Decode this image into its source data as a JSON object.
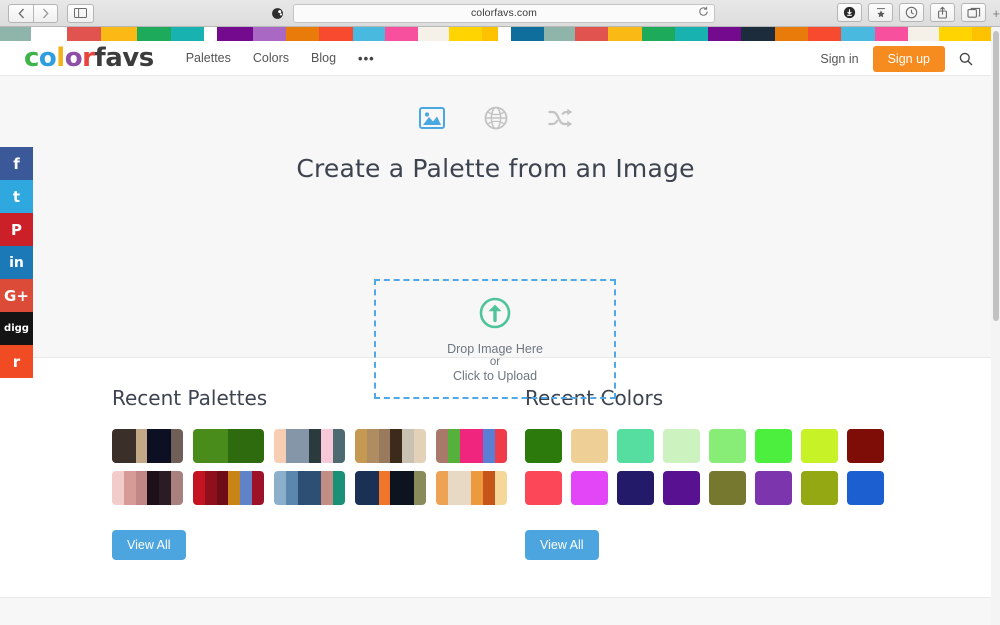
{
  "browser": {
    "back_label": "‹",
    "forward_label": "›",
    "sidebar_icon": "sidebar-icon",
    "url": "colorfavs.com",
    "reload_icon": "reload-icon",
    "favicon": "site-favicon",
    "tools": [
      "download-icon",
      "bookmarks-icon",
      "history-icon",
      "share-icon",
      "tabs-icon"
    ],
    "new_tab_label": "+"
  },
  "color_stripe": [
    "#8fb5ab",
    "#ffffff",
    "#e0534f",
    "#fbb916",
    "#1dab5b",
    "#18b2b0",
    "#ffffff",
    "#740b8e",
    "#a968c4",
    "#e87b09",
    "#f74a2f",
    "#4ab9df",
    "#f7509e",
    "#f5f1e8",
    "#ffd400",
    "#fcc200",
    "#ffffff",
    "#0f6e9c",
    "#8fb5ab",
    "#e0534f",
    "#fbb916",
    "#1dab5b",
    "#18b2b0",
    "#740b8e",
    "#1c2c3c",
    "#e87b09",
    "#f74a2f",
    "#4ab9df",
    "#f7509e",
    "#f5f1e8",
    "#ffd400",
    "#fcc200"
  ],
  "header": {
    "logo_color_text": "color",
    "logo_favs_text": "favs",
    "logo_letters": [
      {
        "ch": "c",
        "color": "#3fb24a"
      },
      {
        "ch": "o",
        "color": "#2f9de0"
      },
      {
        "ch": "l",
        "color": "#f6b21b"
      },
      {
        "ch": "o",
        "color": "#8e4fa8"
      },
      {
        "ch": "r",
        "color": "#e8443c"
      }
    ],
    "nav": [
      {
        "label": "Palettes",
        "name": "nav-palettes"
      },
      {
        "label": "Colors",
        "name": "nav-colors"
      },
      {
        "label": "Blog",
        "name": "nav-blog"
      }
    ],
    "more_label": "•••",
    "sign_in_label": "Sign in",
    "sign_up_label": "Sign up",
    "search_icon": "search-icon",
    "accent_orange": "#f68b1f"
  },
  "hero": {
    "tabs": [
      {
        "icon": "image-icon",
        "name": "tab-from-image",
        "active": true
      },
      {
        "icon": "globe-icon",
        "name": "tab-from-url",
        "active": false
      },
      {
        "icon": "shuffle-icon",
        "name": "tab-random",
        "active": false
      }
    ],
    "title": "Create a Palette from an Image",
    "dropzone": {
      "icon": "upload-arrow-icon",
      "line1": "Drop Image Here",
      "line2": "or",
      "line3": "Click to Upload",
      "border_color": "#4fa8e8",
      "icon_color": "#4ec49a"
    }
  },
  "social": [
    {
      "name": "facebook",
      "label": "f",
      "color": "#3b5998"
    },
    {
      "name": "twitter",
      "label": "t",
      "color": "#2fa8e0"
    },
    {
      "name": "pinterest",
      "label": "P",
      "color": "#cb2027"
    },
    {
      "name": "linkedin",
      "label": "in",
      "color": "#1c79b8"
    },
    {
      "name": "googleplus",
      "label": "G+",
      "color": "#dc4a38"
    },
    {
      "name": "digg",
      "label": "digg",
      "color": "#141414"
    },
    {
      "name": "reddit",
      "label": "r",
      "color": "#f04b23"
    }
  ],
  "palettes_section": {
    "title": "Recent Palettes",
    "view_all_label": "View All",
    "rows": [
      [
        {
          "name": "palette-1",
          "colors": [
            "#3b2f2a",
            "#3b2f2a",
            "#c2a886",
            "#0d0f22",
            "#0d0f22",
            "#6f5f57"
          ]
        },
        {
          "name": "palette-2",
          "colors": [
            "#4a8c1c",
            "#4a8c1c",
            "#4a8c1c",
            "#2e6b0e",
            "#2e6b0e",
            "#2e6b0e"
          ]
        },
        {
          "name": "palette-3",
          "colors": [
            "#f7cdb4",
            "#8496a8",
            "#8496a8",
            "#2b3a3c",
            "#f7c9d8",
            "#4d6a70"
          ]
        },
        {
          "name": "palette-4",
          "colors": [
            "#c49a52",
            "#b08c63",
            "#9a7a5c",
            "#3c2a1a",
            "#c9c2b3",
            "#e3d2b8"
          ]
        },
        {
          "name": "palette-5",
          "colors": [
            "#a8796a",
            "#56b03c",
            "#f0257e",
            "#f0257e",
            "#5b7fd4",
            "#ee3c4a"
          ]
        }
      ],
      [
        {
          "name": "palette-6",
          "colors": [
            "#f2ccc9",
            "#d79b97",
            "#c08784",
            "#1e1018",
            "#2b1b24",
            "#a8807e"
          ]
        },
        {
          "name": "palette-7",
          "colors": [
            "#c41421",
            "#8f0f1c",
            "#6e0d17",
            "#c98418",
            "#5f83c6",
            "#9e1227"
          ]
        },
        {
          "name": "palette-8",
          "colors": [
            "#8cb0cc",
            "#5a87ad",
            "#2e4f74",
            "#2e4f74",
            "#c28d84",
            "#1a9177"
          ]
        },
        {
          "name": "palette-9",
          "colors": [
            "#1a3054",
            "#1a3054",
            "#f0762b",
            "#0d1420",
            "#0d1420",
            "#8a8b5a"
          ]
        },
        {
          "name": "palette-10",
          "colors": [
            "#eda254",
            "#e8d9c4",
            "#e8d9c4",
            "#ec9a3e",
            "#c6551a",
            "#f5d79a"
          ]
        }
      ]
    ]
  },
  "colors_section": {
    "title": "Recent Colors",
    "view_all_label": "View All",
    "rows": [
      [
        {
          "name": "color-swatch-1",
          "hex": "#2b7a0b"
        },
        {
          "name": "color-swatch-2",
          "hex": "#eecf95"
        },
        {
          "name": "color-swatch-3",
          "hex": "#56deA0"
        },
        {
          "name": "color-swatch-4",
          "hex": "#ccf2c0"
        },
        {
          "name": "color-swatch-5",
          "hex": "#88ed77"
        },
        {
          "name": "color-swatch-6",
          "hex": "#4cef3e"
        },
        {
          "name": "color-swatch-7",
          "hex": "#c6f227"
        },
        {
          "name": "color-swatch-8",
          "hex": "#7e0d07"
        }
      ],
      [
        {
          "name": "color-swatch-9",
          "hex": "#fc4759"
        },
        {
          "name": "color-swatch-10",
          "hex": "#e246f7"
        },
        {
          "name": "color-swatch-11",
          "hex": "#231a69"
        },
        {
          "name": "color-swatch-12",
          "hex": "#581191"
        },
        {
          "name": "color-swatch-13",
          "hex": "#77782f"
        },
        {
          "name": "color-swatch-14",
          "hex": "#7c35ad"
        },
        {
          "name": "color-swatch-15",
          "hex": "#93a813"
        },
        {
          "name": "color-swatch-16",
          "hex": "#1c5fd1"
        }
      ]
    ]
  }
}
